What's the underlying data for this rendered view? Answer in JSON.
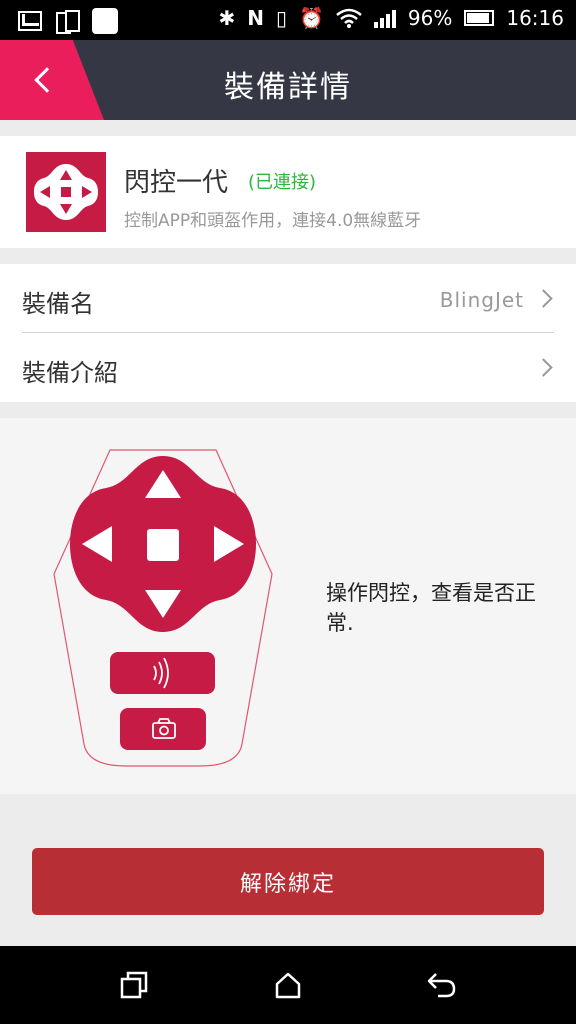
{
  "status_bar": {
    "battery_percent": "96%",
    "time": "16:16",
    "left_icons": [
      "gmail-icon",
      "phones-icon",
      "square-notification-icon"
    ],
    "right_icons": [
      "bluetooth-icon",
      "nfc-icon",
      "vibrate-icon",
      "alarm-icon",
      "wifi-icon",
      "signal-icon",
      "battery-icon"
    ]
  },
  "header": {
    "title": "裝備詳情",
    "accent_color": "#e91e5a",
    "bg_color": "#353844"
  },
  "device": {
    "name": "閃控一代",
    "status": "(已連接)",
    "status_color": "#2db83d",
    "description": "控制APP和頭盔作用，連接4.0無線藍牙",
    "brand_color": "#c51b45"
  },
  "settings": {
    "rows": [
      {
        "label": "裝備名",
        "value": "BlingJet"
      },
      {
        "label": "裝備介紹",
        "value": ""
      }
    ]
  },
  "panel": {
    "instruction": "操作閃控，查看是否正常."
  },
  "actions": {
    "unbind_label": "解除綁定",
    "unbind_color": "#b72f35"
  },
  "nav_bar": {
    "buttons": [
      "recent-apps-icon",
      "home-icon",
      "back-icon"
    ]
  }
}
